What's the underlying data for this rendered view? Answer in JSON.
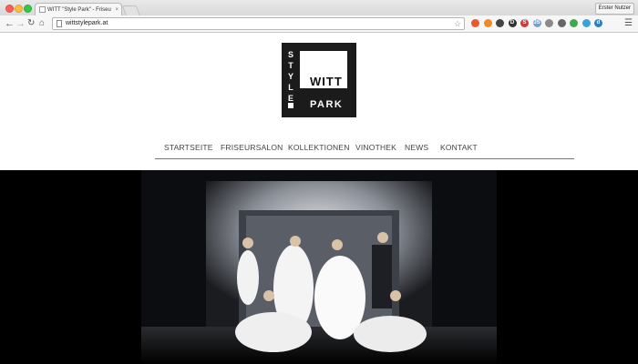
{
  "browser": {
    "tab_title": "WITT \"Style Park\" - Friseu",
    "tab_close": "×",
    "profile_label": "Erster Nutzer",
    "url": "wittstylepark.at",
    "icons": {
      "back": "arrow-left-icon",
      "forward": "arrow-right-icon",
      "reload": "reload-icon",
      "home": "home-icon",
      "star": "star-icon",
      "menu": "hamburger-menu-icon"
    },
    "extensions": [
      {
        "name": "ext-red-circle-icon",
        "glyph": "",
        "color": "#e8582c"
      },
      {
        "name": "ext-orange-fox-icon",
        "glyph": "",
        "color": "#f08a24"
      },
      {
        "name": "ext-eyedropper-icon",
        "glyph": "",
        "color": "#444444"
      },
      {
        "name": "ext-d-badge-icon",
        "glyph": "D",
        "color": "#333333"
      },
      {
        "name": "ext-s-icon",
        "glyph": "S",
        "color": "#d03a3a"
      },
      {
        "name": "ext-js-icon",
        "glyph": "JS",
        "color": "#7ba0d0"
      },
      {
        "name": "ext-flag-icon",
        "glyph": "",
        "color": "#8a8a8a"
      },
      {
        "name": "ext-clock-icon",
        "glyph": "",
        "color": "#666666"
      },
      {
        "name": "ext-green-wave-icon",
        "glyph": "",
        "color": "#3faa4a"
      },
      {
        "name": "ext-cloud-icon",
        "glyph": "",
        "color": "#3aa0d8"
      },
      {
        "name": "ext-d-blue-icon",
        "glyph": "d",
        "color": "#2d7fc1"
      }
    ]
  },
  "site": {
    "logo": {
      "style_text": "STYLE",
      "witt_text": "WITT",
      "park_text": "PARK"
    },
    "nav": [
      {
        "label": "STARTSEITE"
      },
      {
        "label": "FRISEURSALON"
      },
      {
        "label": "KOLLEKTIONEN"
      },
      {
        "label": "VINOTHEK"
      },
      {
        "label": "NEWS"
      },
      {
        "label": "KONTAKT"
      }
    ]
  },
  "colors": {
    "logo_bg": "#1b1b1b",
    "hero_bg": "#000000",
    "nav_text": "#444444"
  }
}
